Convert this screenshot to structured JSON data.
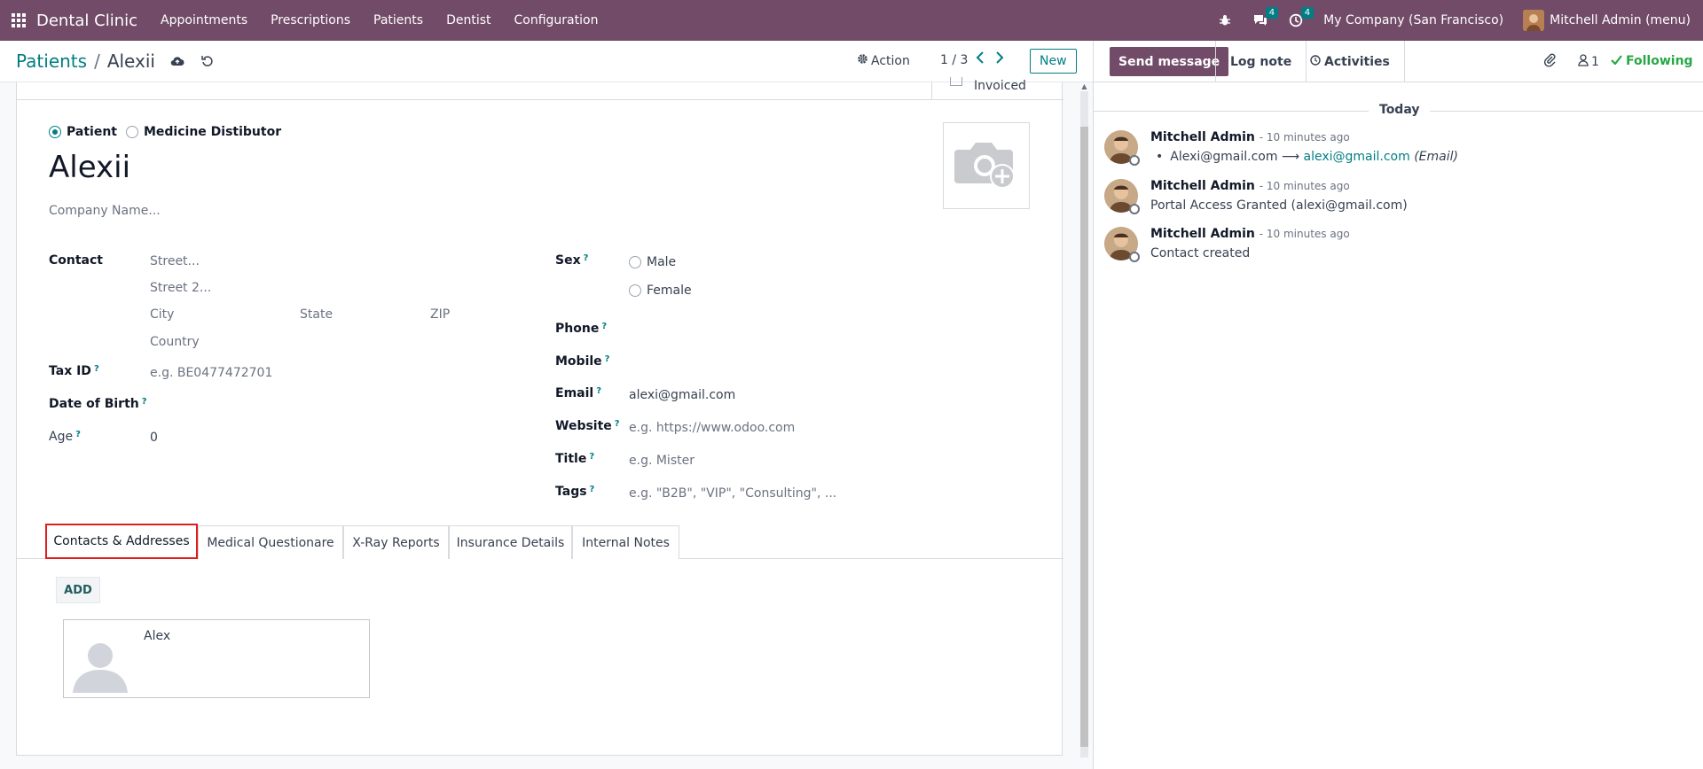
{
  "navbar": {
    "brand": "Dental Clinic",
    "menu": [
      "Appointments",
      "Prescriptions",
      "Patients",
      "Dentist",
      "Configuration"
    ],
    "messages_count": "4",
    "activities_count": "4",
    "company": "My Company (San Francisco)",
    "user": "Mitchell Admin (menu)"
  },
  "control": {
    "breadcrumb_parent": "Patients",
    "breadcrumb_sep": "/",
    "breadcrumb_current": "Alexii",
    "action_label": "Action",
    "pager": "1 / 3",
    "new_label": "New"
  },
  "status": {
    "invoiced_label": "Invoiced"
  },
  "form": {
    "type_options": [
      "Patient",
      "Medicine Distibutor"
    ],
    "selected_type": "Patient",
    "name": "Alexii",
    "company_placeholder": "Company Name...",
    "contact_label": "Contact",
    "street_placeholder": "Street...",
    "street2_placeholder": "Street 2...",
    "city_placeholder": "City",
    "state_placeholder": "State",
    "zip_placeholder": "ZIP",
    "country_placeholder": "Country",
    "tax_id_label": "Tax ID",
    "tax_id_placeholder": "e.g. BE0477472701",
    "dob_label": "Date of Birth",
    "age_label": "Age",
    "age_value": "0",
    "sex_label": "Sex",
    "sex_options": [
      "Male",
      "Female"
    ],
    "phone_label": "Phone",
    "mobile_label": "Mobile",
    "email_label": "Email",
    "email_value": "alexi@gmail.com",
    "website_label": "Website",
    "website_placeholder": "e.g. https://www.odoo.com",
    "title_label": "Title",
    "title_placeholder": "e.g. Mister",
    "tags_label": "Tags",
    "tags_placeholder": "e.g. \"B2B\", \"VIP\", \"Consulting\", ...",
    "help_mark": "?"
  },
  "tabs": [
    "Contacts & Addresses",
    "Medical Questionare",
    "X-Ray Reports",
    "Insurance Details",
    "Internal Notes"
  ],
  "active_tab": "Contacts & Addresses",
  "contacts": {
    "add_label": "ADD",
    "items": [
      {
        "name": "Alex"
      }
    ]
  },
  "chatter": {
    "send_message": "Send message",
    "log_note": "Log note",
    "activities": "Activities",
    "followers_count": "1",
    "following": "Following",
    "date_separator": "Today",
    "messages": [
      {
        "author": "Mitchell Admin",
        "time": "- 10 minutes ago",
        "old_value": "Alexi@gmail.com",
        "arrow": "⟶",
        "new_value": "alexi@gmail.com",
        "field": "(Email)"
      },
      {
        "author": "Mitchell Admin",
        "time": "- 10 minutes ago",
        "body": "Portal Access Granted (alexi@gmail.com)"
      },
      {
        "author": "Mitchell Admin",
        "time": "- 10 minutes ago",
        "body": "Contact created"
      }
    ]
  },
  "colors": {
    "brand": "#714b67",
    "accent": "#017e84",
    "following": "#28a745",
    "highlight": "#e01e1e"
  }
}
